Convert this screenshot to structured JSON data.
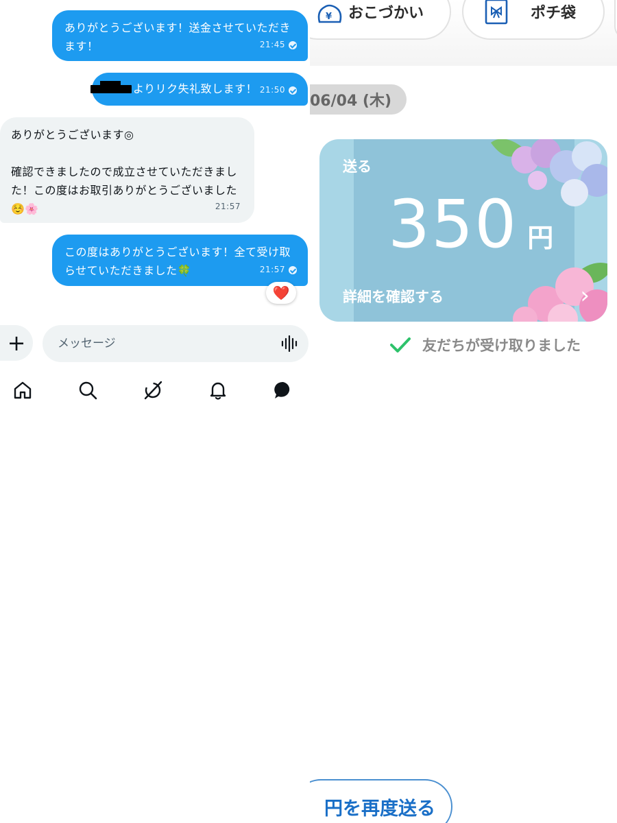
{
  "chat": {
    "messages": [
      {
        "side": "sent",
        "text": "ありがとうございます！送金させていただきます！",
        "time": "21:45"
      },
      {
        "side": "sent",
        "text": "よりリク失礼致します！",
        "time": "21:50"
      },
      {
        "side": "received",
        "text": "ありがとうございます◎\n\n確認できましたので成立させていただきました！この度はお取引ありがとうございました☺️🌸",
        "time": "21:57"
      },
      {
        "side": "sent",
        "text": "この度はありがとうございます！全て受け取らせていただきました🍀",
        "time": "21:57"
      }
    ],
    "reaction": "❤️",
    "composer": {
      "placeholder": "メッセージ",
      "add_label": "+"
    }
  },
  "nav": {
    "items": [
      "home",
      "search",
      "grok",
      "notifications",
      "messages"
    ]
  },
  "payment": {
    "top_buttons": [
      {
        "label": "おこづかい",
        "icon": "yen-pouch-icon"
      },
      {
        "label": "ポチ袋",
        "icon": "gift-envelope-icon"
      }
    ],
    "date": "06/04 (木)",
    "card": {
      "title": "送る",
      "amount": "350",
      "unit": "円",
      "detail_link": "詳細を確認する",
      "colors": {
        "background": "#a8d6e6",
        "band": "#8fc3d9"
      }
    },
    "status": "友だちが受け取りました",
    "status_color": "#2ec26b",
    "resend_label": "円を再度送る"
  },
  "colors": {
    "accent": "#1d9bf0",
    "bubble_received": "#eff3f4"
  }
}
